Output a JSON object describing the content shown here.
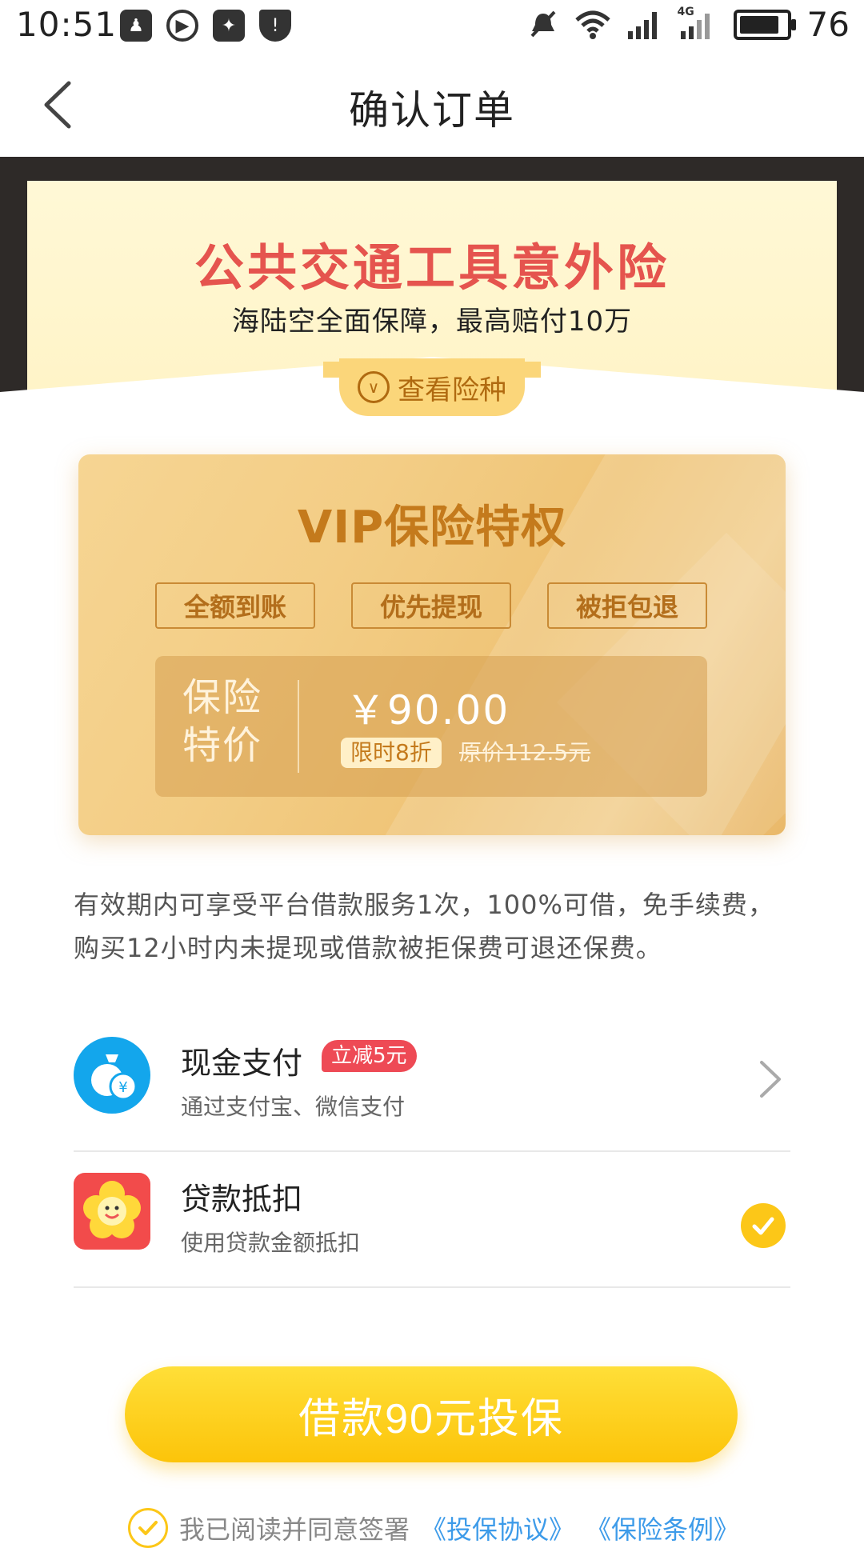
{
  "status_bar": {
    "time": "10:51",
    "battery": "76",
    "network_label": "4G"
  },
  "nav": {
    "title": "确认订单"
  },
  "hero": {
    "title": "公共交通工具意外险",
    "subtitle": "海陆空全面保障，最高赔付10万",
    "view_button_label": "查看险种"
  },
  "vip": {
    "title": "VIP保险特权",
    "tags": [
      "全额到账",
      "优先提现",
      "被拒包退"
    ],
    "price_label_line1": "保险",
    "price_label_line2": "特价",
    "price": "￥90.00",
    "discount_badge": "限时8折",
    "original_price": "原价112.5元"
  },
  "description": "有效期内可享受平台借款服务1次，100%可借，免手续费，购买12小时内未提现或借款被拒保费可退还保费。",
  "payment": {
    "items": [
      {
        "title": "现金支付",
        "badge": "立减5元",
        "subtitle": "通过支付宝、微信支付",
        "selected": false,
        "icon": "money-bag-icon",
        "icon_color": "#13a6ec"
      },
      {
        "title": "贷款抵扣",
        "badge": "",
        "subtitle": "使用贷款金额抵扣",
        "selected": true,
        "icon": "flower-mascot-icon",
        "icon_color": "#f24b4b"
      }
    ]
  },
  "cta": {
    "label": "借款90元投保"
  },
  "agreement": {
    "prefix": "我已阅读并同意签署",
    "link1": "《投保协议》",
    "link2": "《保险条例》"
  },
  "colors": {
    "accent": "#fcc718",
    "brand_red": "#e5544e",
    "gold_text": "#c47a1c",
    "link": "#3d9be9"
  }
}
